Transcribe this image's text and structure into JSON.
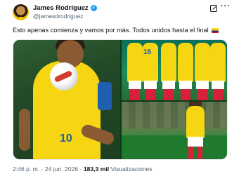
{
  "author": {
    "name": "James Rodríguez",
    "handle": "@jamesdrodriguez",
    "verified_icon": "verified-badge-icon"
  },
  "tweet": {
    "text": "Esto apenas comienza y vamos por más. Todos unidos hasta el final",
    "emoji": "colombia-flag-icon"
  },
  "meta": {
    "time": "2:46 p. m.",
    "sep1": " · ",
    "date": "24 jun. 2026",
    "sep2": " · ",
    "views_count": "183,3 mil",
    "views_label": " Visualizaciones"
  },
  "colors": {
    "text_primary": "#0f1419",
    "text_secondary": "#536471",
    "verified": "#1d9bf0",
    "jersey_yellow": "#f6d613"
  }
}
